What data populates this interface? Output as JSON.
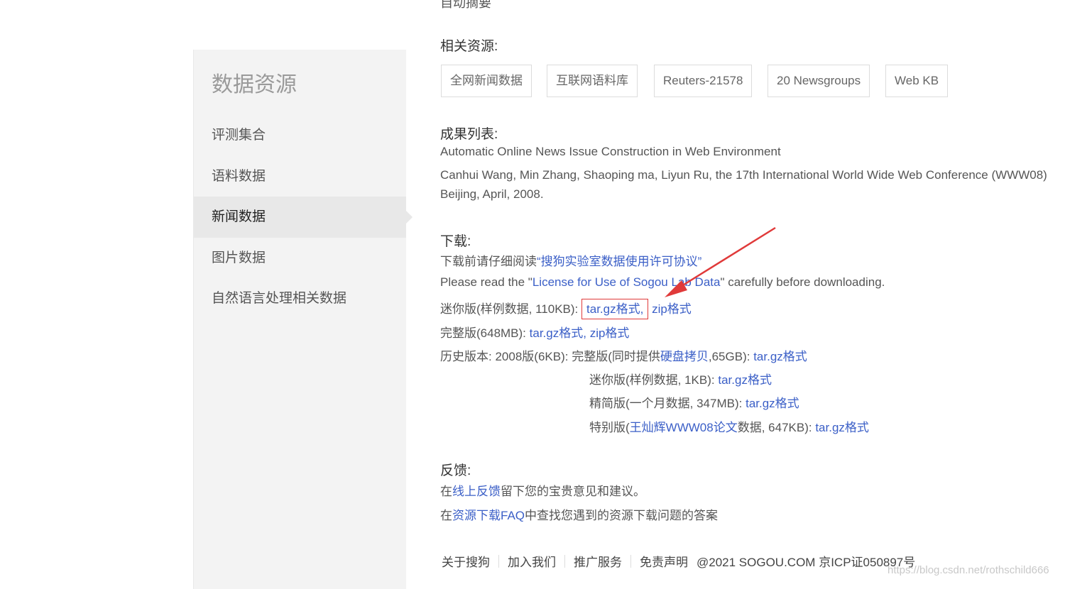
{
  "top_partial": "自动摘要",
  "sidebar": {
    "title": "数据资源",
    "items": [
      {
        "label": "评测集合"
      },
      {
        "label": "语料数据"
      },
      {
        "label": "新闻数据"
      },
      {
        "label": "图片数据"
      },
      {
        "label": "自然语言处理相关数据"
      }
    ],
    "active_index": 2
  },
  "related": {
    "title": "相关资源:",
    "tags": [
      "全网新闻数据",
      "互联网语料库",
      "Reuters-21578",
      "20 Newsgroups",
      "Web KB"
    ]
  },
  "results": {
    "title": "成果列表:",
    "paper_link": "Automatic Online News Issue Construction in Web Environment",
    "authors_line1": "Canhui Wang, Min Zhang, Shaoping ma, Liyun Ru, the 17th International World Wide Web Conference (WWW08)",
    "authors_line2": "Beijing, April, 2008."
  },
  "download": {
    "title": "下载:",
    "read_prefix": "下载前请仔细阅读",
    "read_link": "“搜狗实验室数据使用许可协议”",
    "en_prefix": "Please read the \"",
    "en_link": "License for Use of Sogou Lab Data",
    "en_suffix": "\" carefully before downloading.",
    "mini_label": "迷你版(样例数据, 110KB):",
    "mini_tar": "tar.gz格式,",
    "mini_zip": "zip格式",
    "full_label": "完整版(648MB):",
    "full_tar": "tar.gz格式,",
    "full_zip": "zip格式",
    "history_label": "历史版本:",
    "history_2008": "2008版(6KB):",
    "hist_full_prefix": "完整版(同时提供",
    "hist_full_link": "硬盘拷贝",
    "hist_full_suffix": ",65GB):",
    "hist_full_tar": "tar.gz格式",
    "hist_mini_label": "迷你版(样例数据, 1KB):",
    "hist_mini_tar": "tar.gz格式",
    "hist_lite_label": "精简版(一个月数据, 347MB):",
    "hist_lite_tar": "tar.gz格式",
    "hist_special_prefix": "特别版(",
    "hist_special_link": "王灿辉WWW08论文",
    "hist_special_suffix": "数据, 647KB):",
    "hist_special_tar": "tar.gz格式"
  },
  "feedback": {
    "title": "反馈:",
    "line1_prefix": "在",
    "line1_link": "线上反馈",
    "line1_suffix": "留下您的宝贵意见和建议。",
    "line2_prefix": "在",
    "line2_link": "资源下载FAQ",
    "line2_suffix": "中查找您遇到的资源下载问题的答案"
  },
  "footer": {
    "links": [
      "关于搜狗",
      "加入我们",
      "推广服务",
      "免责声明"
    ],
    "copyright": "@2021 SOGOU.COM 京ICP证050897号"
  },
  "watermark": "https://blog.csdn.net/rothschild666",
  "colors": {
    "link": "#3b5fc7",
    "highlight_box": "#e03a3a",
    "arrow": "#e03a3a",
    "sidebar_bg": "#f3f3f3"
  }
}
